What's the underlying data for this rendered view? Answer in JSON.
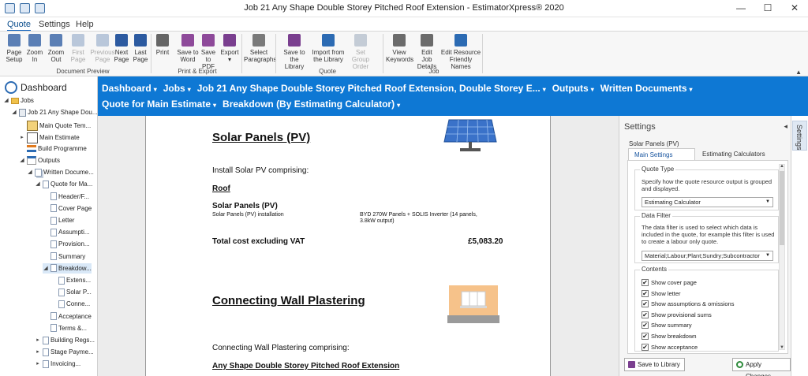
{
  "window": {
    "title": "Job 21 Any Shape Double Storey Pitched Roof Extension - EstimatorXpress® 2020",
    "controls": [
      "—",
      "☐",
      "✕"
    ]
  },
  "menu_tabs": [
    "Quote",
    "Settings",
    "Help"
  ],
  "ribbon": {
    "buttons": [
      {
        "l1": "Page",
        "l2": "Setup",
        "icon": "page-setup-icon",
        "color": "#5b7fb5",
        "enabled": true
      },
      {
        "l1": "Zoom",
        "l2": "In",
        "icon": "zoom-in-icon",
        "color": "#5b7fb5",
        "enabled": true
      },
      {
        "l1": "Zoom",
        "l2": "Out",
        "icon": "zoom-out-icon",
        "color": "#5b7fb5",
        "enabled": true
      },
      {
        "l1": "First",
        "l2": "Page",
        "icon": "first-page-icon",
        "color": "#b9c7da",
        "enabled": false
      },
      {
        "l1": "Previous",
        "l2": "Page",
        "icon": "previous-page-icon",
        "color": "#b9c7da",
        "enabled": false
      },
      {
        "l1": "Next",
        "l2": "Page",
        "icon": "next-page-icon",
        "color": "#2c5aa0",
        "enabled": true
      },
      {
        "l1": "Last",
        "l2": "Page",
        "icon": "last-page-icon",
        "color": "#2c5aa0",
        "enabled": true
      },
      {
        "l1": "Print",
        "l2": "",
        "icon": "print-icon",
        "color": "#666666",
        "enabled": true
      },
      {
        "l1": "Save to",
        "l2": "Word",
        "icon": "save-to-word-icon",
        "color": "#8e4a9a",
        "enabled": true
      },
      {
        "l1": "Save",
        "l2": "to PDF",
        "icon": "save-to-pdf-icon",
        "color": "#8e4a9a",
        "enabled": true
      },
      {
        "l1": "Export",
        "l2": "▾",
        "icon": "export-icon",
        "color": "#7a3f8f",
        "enabled": true
      },
      {
        "l1": "Select",
        "l2": "Paragraphs",
        "icon": "select-paragraphs-icon",
        "color": "#7a7a7a",
        "enabled": true
      },
      {
        "l1": "Save to the",
        "l2": "Library",
        "icon": "save-to-library-icon",
        "color": "#7a3f8f",
        "enabled": true
      },
      {
        "l1": "Import from",
        "l2": "the Library",
        "icon": "import-library-icon",
        "color": "#2c6bb3",
        "enabled": true
      },
      {
        "l1": "Set Group",
        "l2": "Order",
        "icon": "set-group-order-icon",
        "color": "#c4ccd6",
        "enabled": false
      },
      {
        "l1": "View",
        "l2": "Keywords",
        "icon": "view-keywords-icon",
        "color": "#6b6b6b",
        "enabled": true
      },
      {
        "l1": "Edit Job",
        "l2": "Details",
        "icon": "edit-job-details-icon",
        "color": "#6b6b6b",
        "enabled": true
      },
      {
        "l1": "Edit Resource",
        "l2": "Friendly Names",
        "icon": "edit-resource-names-icon",
        "color": "#2c6bb3",
        "enabled": true
      }
    ],
    "groups": [
      "Document Preview",
      "Print & Export",
      "Quote",
      "Job"
    ]
  },
  "sidebar": {
    "header": "Dashboard",
    "items": [
      {
        "label": "Jobs",
        "indent": 0,
        "toggle": "◢",
        "icon": "folder-icon"
      },
      {
        "label": "Job 21 Any Shape Dou...",
        "indent": 1,
        "toggle": "◢",
        "icon": "job-icon"
      },
      {
        "label": "Main Quote Tem...",
        "indent": 2,
        "toggle": "",
        "icon": "house-icon"
      },
      {
        "label": "Main Estimate",
        "indent": 2,
        "toggle": "▸",
        "icon": "calculator-icon"
      },
      {
        "label": "Build Programme",
        "indent": 2,
        "toggle": "",
        "icon": "gantt-icon"
      },
      {
        "label": "Outputs",
        "indent": 2,
        "toggle": "◢",
        "icon": "outputs-icon"
      },
      {
        "label": "Written Docume...",
        "indent": 3,
        "toggle": "◢",
        "icon": "documents-icon"
      },
      {
        "label": "Quote for Ma...",
        "indent": 4,
        "toggle": "◢",
        "icon": "document-icon"
      },
      {
        "label": "Header/F...",
        "indent": 5,
        "toggle": "",
        "icon": "document-icon"
      },
      {
        "label": "Cover Page",
        "indent": 5,
        "toggle": "",
        "icon": "document-icon"
      },
      {
        "label": "Letter",
        "indent": 5,
        "toggle": "",
        "icon": "document-icon"
      },
      {
        "label": "Assumpti...",
        "indent": 5,
        "toggle": "",
        "icon": "document-icon"
      },
      {
        "label": "Provision...",
        "indent": 5,
        "toggle": "",
        "icon": "document-icon"
      },
      {
        "label": "Summary",
        "indent": 5,
        "toggle": "",
        "icon": "document-icon"
      },
      {
        "label": "Breakdow...",
        "indent": 5,
        "toggle": "◢",
        "icon": "document-icon"
      },
      {
        "label": "Extens...",
        "indent": 6,
        "toggle": "",
        "icon": "document-icon"
      },
      {
        "label": "Solar P...",
        "indent": 6,
        "toggle": "",
        "icon": "document-icon"
      },
      {
        "label": "Conne...",
        "indent": 6,
        "toggle": "",
        "icon": "document-icon"
      },
      {
        "label": "Acceptance",
        "indent": 5,
        "toggle": "",
        "icon": "document-icon"
      },
      {
        "label": "Terms &...",
        "indent": 5,
        "toggle": "",
        "icon": "document-icon"
      },
      {
        "label": "Building Regs...",
        "indent": 4,
        "toggle": "▸",
        "icon": "document-icon"
      },
      {
        "label": "Stage Payme...",
        "indent": 4,
        "toggle": "▸",
        "icon": "document-icon"
      },
      {
        "label": "Invoicing...",
        "indent": 4,
        "toggle": "▸",
        "icon": "document-icon"
      }
    ]
  },
  "breadcrumb": {
    "items": [
      "Dashboard",
      "Jobs",
      "Job 21 Any Shape Double Storey Pitched Roof Extension, Double Storey E...",
      "Outputs",
      "Written Documents",
      "Quote for Main Estimate",
      "Breakdown (By Estimating Calculator)"
    ]
  },
  "document": {
    "section1": {
      "title": "Solar Panels (PV)",
      "intro": "Install Solar PV comprising:",
      "subheading": "Roof",
      "item_title": "Solar Panels (PV)",
      "item_desc": "Solar Panels (PV) installation",
      "item_spec": "BYD 270W Panels + SOLIS Inverter (14 panels, 3.8kW output)",
      "total_label": "Total cost excluding VAT",
      "total_value": "£5,083.20"
    },
    "section2": {
      "title": "Connecting Wall Plastering",
      "intro": "Connecting Wall Plastering comprising:",
      "subheading": "Any Shape Double Storey Pitched Roof Extension"
    }
  },
  "settings_panel": {
    "title": "Settings",
    "collapse_glyph": "◂",
    "context": "Solar Panels (PV)",
    "tabs": [
      "Main Settings",
      "Estimating Calculators"
    ],
    "quote_type": {
      "legend": "Quote Type",
      "desc": "Specify how the quote resource output is grouped and displayed.",
      "value": "Estimating Calculator"
    },
    "data_filter": {
      "legend": "Data Filter",
      "desc": "The data filter is used to select which data is included in the quote, for example this filter is used to create a labour only quote.",
      "value": "Material;Labour;Plant;Sundry;Subcontractor"
    },
    "contents": {
      "legend": "Contents",
      "items": [
        {
          "label": "Show cover page",
          "checked": "✔"
        },
        {
          "label": "Show letter",
          "checked": "✔"
        },
        {
          "label": "Show assumptions & omissions",
          "checked": "✔"
        },
        {
          "label": "Show provisional sums",
          "checked": "✔"
        },
        {
          "label": "Show summary",
          "checked": "✔"
        },
        {
          "label": "Show breakdown",
          "checked": "✔"
        },
        {
          "label": "Show acceptance",
          "checked": "✔"
        }
      ]
    },
    "save_button": "Save to Library",
    "apply_button": "Apply Changes"
  },
  "side_tab": "Settings",
  "colors": {
    "accent": "#0e78d4",
    "selected": "#d9e8f7"
  }
}
